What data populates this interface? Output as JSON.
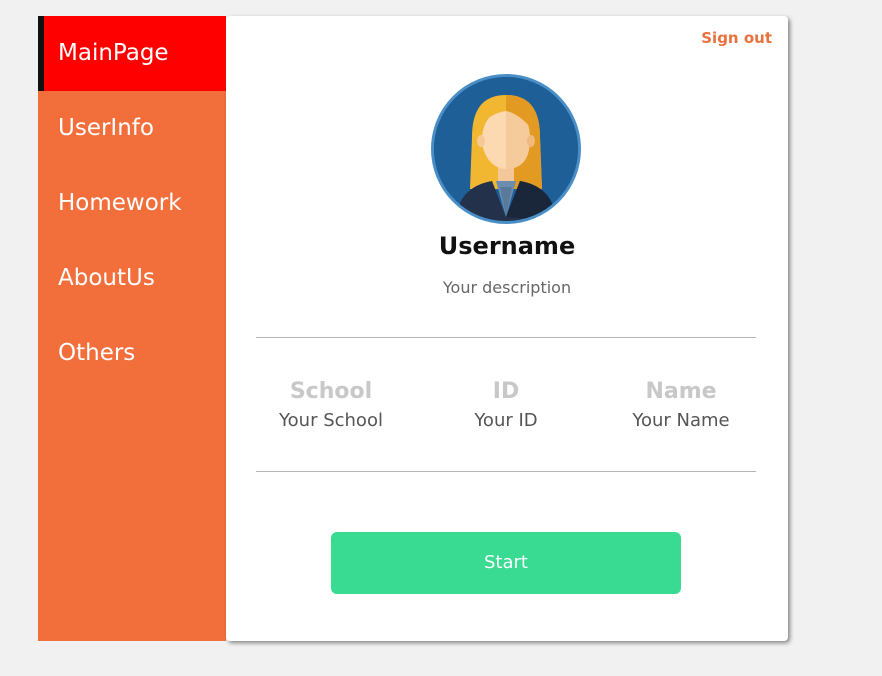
{
  "sidebar": {
    "items": [
      {
        "label": "MainPage",
        "active": true
      },
      {
        "label": "UserInfo",
        "active": false
      },
      {
        "label": "Homework",
        "active": false
      },
      {
        "label": "AboutUs",
        "active": false
      },
      {
        "label": "Others",
        "active": false
      }
    ],
    "background_color": "#f26f3c",
    "active_color": "#ff0000"
  },
  "header": {
    "sign_out_label": "Sign out"
  },
  "profile": {
    "avatar_icon": "user-avatar-icon",
    "username": "Username",
    "description": "Your description"
  },
  "info": [
    {
      "label": "School",
      "value": "Your School"
    },
    {
      "label": "ID",
      "value": "Your ID"
    },
    {
      "label": "Name",
      "value": "Your Name"
    }
  ],
  "actions": {
    "start_label": "Start",
    "start_color": "#38db91"
  }
}
